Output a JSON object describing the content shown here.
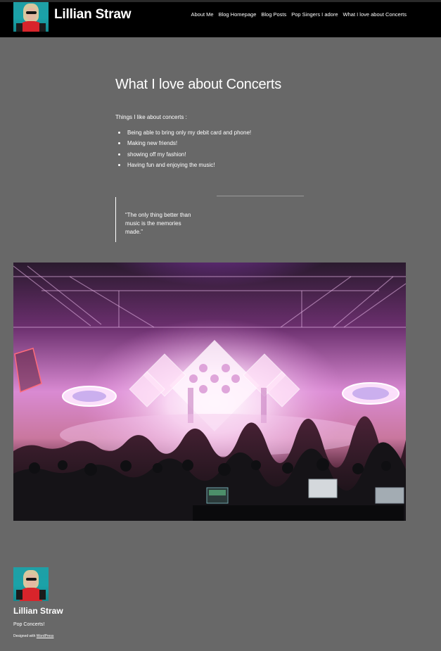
{
  "header": {
    "site_title": "Lillian Straw",
    "avatar_icon": "profile-photo-icon"
  },
  "nav": {
    "items": [
      {
        "label": "About Me"
      },
      {
        "label": "Blog Homepage"
      },
      {
        "label": "Blog Posts"
      },
      {
        "label": "Pop Singers I adore"
      },
      {
        "label": "What I love about Concerts"
      }
    ]
  },
  "main": {
    "title": "What I love about Concerts",
    "intro": "Things I like about concerts :",
    "list": [
      "Being able to bring only my debit card and phone!",
      "Making new friends!",
      "showing off my fashion!",
      "Having fun and enjoying the music!"
    ],
    "quote": "“The only thing better than music is the memories made.”",
    "image_icon": "concert-photo"
  },
  "footer": {
    "title": "Lillian Straw",
    "tagline": "Pop Concerts!",
    "credit_prefix": "Designed with",
    "credit_link": "WordPress"
  },
  "colors": {
    "background": "#686868",
    "header": "#000000",
    "text": "#ffffff"
  }
}
